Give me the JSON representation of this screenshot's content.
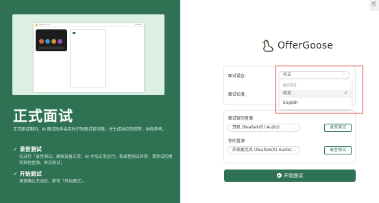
{
  "window": {
    "control_icon": "sliders-icon"
  },
  "left": {
    "preview": {
      "app_label": "OfferGoose"
    },
    "title": "正式面试",
    "description": "正式面试期间，AI 面试助手会实时识别面试官问题，并生成对应的回答，供你参考。",
    "steps": [
      {
        "check": "✓",
        "title": "录音测试",
        "text": "先进行「录音测试」确保设备正常，AI 才能正常运行。若录音测试异常，请参试切换到其他音源，再次测试；"
      },
      {
        "check": "✓",
        "title": "开始面试",
        "text": "录音确认无误后，即可「开始面试」。"
      }
    ]
  },
  "logo": {
    "name": "OfferGoose"
  },
  "settings": {
    "language_label": "面试语言:",
    "language_value": "中文",
    "duration_label": "面试长度:"
  },
  "dropdown": {
    "header": "面试语言",
    "options": [
      {
        "label": "中文",
        "selected": true
      },
      {
        "label": "English",
        "selected": false
      }
    ],
    "check": "✓"
  },
  "audio": {
    "interviewer_label": "面试官的音源",
    "interviewer_value": "耳机 (Realtek(R) Audio)",
    "your_label": "你的音源",
    "your_value": "外部麦克风 (Realtek(R) Audio)",
    "test_button": "录音测试"
  },
  "start_button": "开始面试",
  "colors": {
    "brand_green": "#2e7253",
    "highlight_red": "#e0322a"
  }
}
